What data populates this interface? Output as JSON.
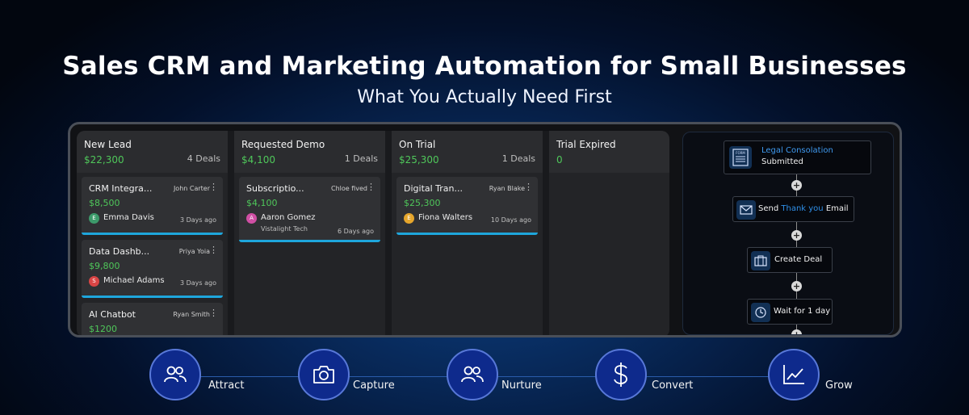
{
  "header": {
    "title": "Sales CRM and Marketing Automation for Small Businesses",
    "subtitle": "What You Actually Need First"
  },
  "pipeline": {
    "columns": [
      {
        "title": "New Lead",
        "amount": "$22,300",
        "count": "4 Deals",
        "cards": [
          {
            "name": "CRM Integra...",
            "owner": "John Carter",
            "amount": "$8,500",
            "avatar": "E",
            "person": "Emma Davis",
            "company": "",
            "time": "3 Days ago",
            "avatar_color": "#3d9a6b"
          },
          {
            "name": "Data Dashb...",
            "owner": "Priya Yoia",
            "amount": "$9,800",
            "avatar": "S",
            "person": "Michael Adams",
            "company": "",
            "time": "3 Days ago",
            "avatar_color": "#d94545"
          },
          {
            "name": "AI Chatbot",
            "owner": "Ryan Smith",
            "amount": "$1200",
            "avatar": "",
            "person": "",
            "company": "",
            "time": "",
            "avatar_color": ""
          }
        ]
      },
      {
        "title": "Requested Demo",
        "amount": "$4,100",
        "count": "1 Deals",
        "cards": [
          {
            "name": "Subscriptio...",
            "owner": "Chloe fived",
            "amount": "$4,100",
            "avatar": "A",
            "person": "Aaron Gomez",
            "company": "Vistalight Tech",
            "time": "6 Days ago",
            "avatar_color": "#d04fa4"
          }
        ]
      },
      {
        "title": "On Trial",
        "amount": "$25,300",
        "count": "1 Deals",
        "cards": [
          {
            "name": "Digital Tran...",
            "owner": "Ryan Blake",
            "amount": "$25,300",
            "avatar": "E",
            "person": "Fiona Walters",
            "company": "",
            "time": "10 Days ago",
            "avatar_color": "#e6a62c"
          }
        ]
      },
      {
        "title": "Trial Expired",
        "amount": "0",
        "count": "",
        "cards": []
      }
    ]
  },
  "workflow": {
    "trigger_title": "Legal Consolation",
    "trigger_sub": "Submitted",
    "form_icon_text": "FORM",
    "email_pre": "Send ",
    "email_highlight": "Thank you",
    "email_post": " Email",
    "create_deal": "Create Deal",
    "wait": "Wait for 1 day",
    "plus": "+",
    "accent_color": "#2f8fe8"
  },
  "steps": [
    {
      "label": "Attract",
      "icon": "users-icon"
    },
    {
      "label": "Capture",
      "icon": "camera-icon"
    },
    {
      "label": "Nurture",
      "icon": "users-icon"
    },
    {
      "label": "Convert",
      "icon": "dollar-icon"
    },
    {
      "label": "Grow",
      "icon": "growth-chart-icon"
    }
  ]
}
